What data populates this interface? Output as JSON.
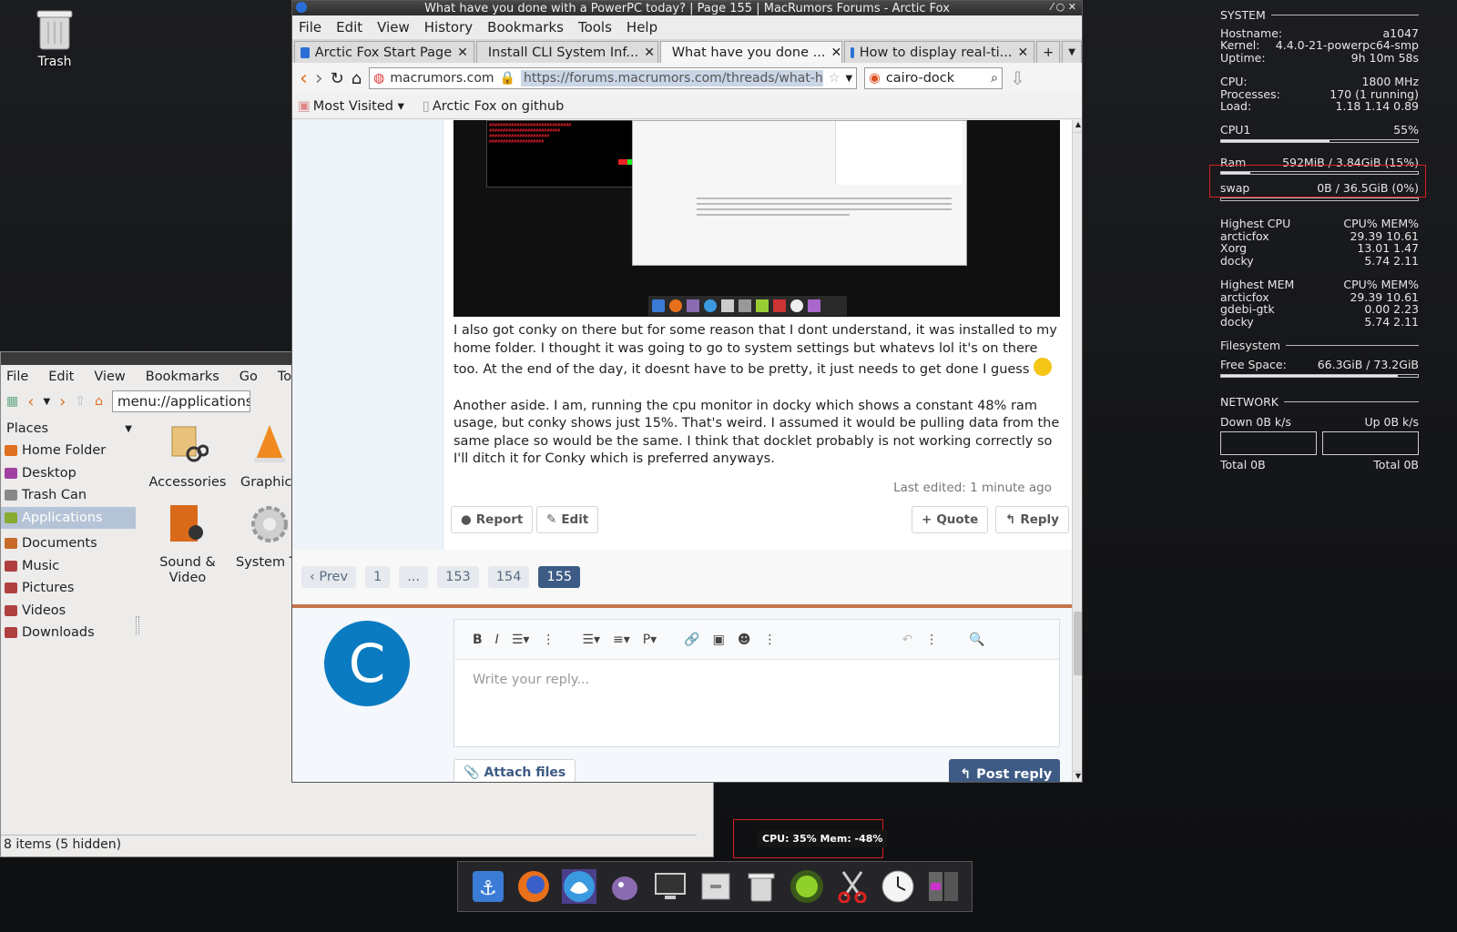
{
  "desktop": {
    "trash_label": "Trash"
  },
  "conky": {
    "system_header": "SYSTEM",
    "hostname_label": "Hostname:",
    "hostname": "a1047",
    "kernel_label": "Kernel:",
    "kernel": "4.4.0-21-powerpc64-smp",
    "uptime_label": "Uptime:",
    "uptime": "9h 10m 58s",
    "cpu_label": "CPU:",
    "cpu": "1800 MHz",
    "processes_label": "Processes:",
    "processes": "170 (1 running)",
    "load_label": "Load:",
    "load": "1.18 1.14 0.89",
    "cpu1_label": "CPU1",
    "cpu1": "55%",
    "cpu1_fraction": 0.55,
    "ram_label": "Ram",
    "ram": "592MiB / 3.84GiB (15%)",
    "ram_fraction": 0.15,
    "swap_label": "swap",
    "swap": "0B   / 36.5GiB (0%)",
    "swap_fraction": 0.0,
    "highest_cpu_label": "Highest CPU",
    "cols_label": "CPU% MEM%",
    "highest_cpu": [
      {
        "name": "arcticfox",
        "vals": "29.39 10.61"
      },
      {
        "name": "Xorg",
        "vals": "13.01  1.47"
      },
      {
        "name": "docky",
        "vals": "5.74  2.11"
      }
    ],
    "highest_mem_label": "Highest MEM",
    "highest_mem": [
      {
        "name": "arcticfox",
        "vals": "29.39 10.61"
      },
      {
        "name": "gdebi-gtk",
        "vals": "0.00  2.23"
      },
      {
        "name": "docky",
        "vals": "5.74  2.11"
      }
    ],
    "filesystem_header": "Filesystem",
    "free_label": "Free Space:",
    "free": "66.3GiB / 73.2GiB",
    "free_fraction": 0.9,
    "network_header": "NETWORK",
    "down": "Down 0B   k/s",
    "up": "Up 0B   k/s",
    "total_down": "Total 0B",
    "total_up": "Total 0B"
  },
  "filemanager": {
    "menu": [
      "File",
      "Edit",
      "View",
      "Bookmarks",
      "Go",
      "Tools"
    ],
    "location": "menu://applications/",
    "places_label": "Places",
    "places": [
      "Home Folder",
      "Desktop",
      "Trash Can",
      "Applications",
      "Documents",
      "Music",
      "Pictures",
      "Videos",
      "Downloads"
    ],
    "apps": [
      "Accessories",
      "Graphics",
      "Sound & Video",
      "System To"
    ],
    "status": "8 items (5 hidden)",
    "colors": {
      "selected": "#b5c3d6"
    }
  },
  "browser": {
    "title": "What have you done with a PowerPC today? | Page 155 | MacRumors Forums - Arctic Fox",
    "menu": [
      "File",
      "Edit",
      "View",
      "History",
      "Bookmarks",
      "Tools",
      "Help"
    ],
    "tabs": [
      "Arctic Fox Start Page",
      "Install CLI System Inf...",
      "What have you done ...",
      "How to display real-ti..."
    ],
    "site": "macrumors.com",
    "url": "https://forums.macrumors.com/threads/what-have",
    "search": "cairo-dock",
    "bookmarks": [
      "Most Visited",
      "Arctic Fox on github"
    ],
    "post_p1": "I also got conky on there but for some reason that I dont understand, it was installed to my home folder. I thought it was going to go to system settings but whatevs lol it's on there too. At the end of the day, it doesnt have to be pretty, it just needs to get done I guess",
    "post_p2": "Another aside. I am, running the cpu monitor in docky which shows a constant 48% ram usage, but conky shows just 15%. That's weird. I assumed it would be pulling data from the same place so would be the same. I think that docklet probably is not working correctly so I'll ditch it for Conky which is preferred anyways.",
    "last_edited": "Last edited: 1 minute ago",
    "report": "Report",
    "edit": "Edit",
    "quote": "Quote",
    "reply": "Reply",
    "pager": [
      "‹ Prev",
      "1",
      "...",
      "153",
      "154",
      "155"
    ],
    "avatar_letter": "C",
    "reply_placeholder": "Write your reply...",
    "attach": "Attach files",
    "post_reply": "Post reply",
    "colors": {
      "accent": "#3d5b84",
      "avatar": "#0a7bc1",
      "divider": "#c6734a"
    }
  },
  "dock": {
    "tooltip": "CPU: 35%  Mem: -48%"
  }
}
